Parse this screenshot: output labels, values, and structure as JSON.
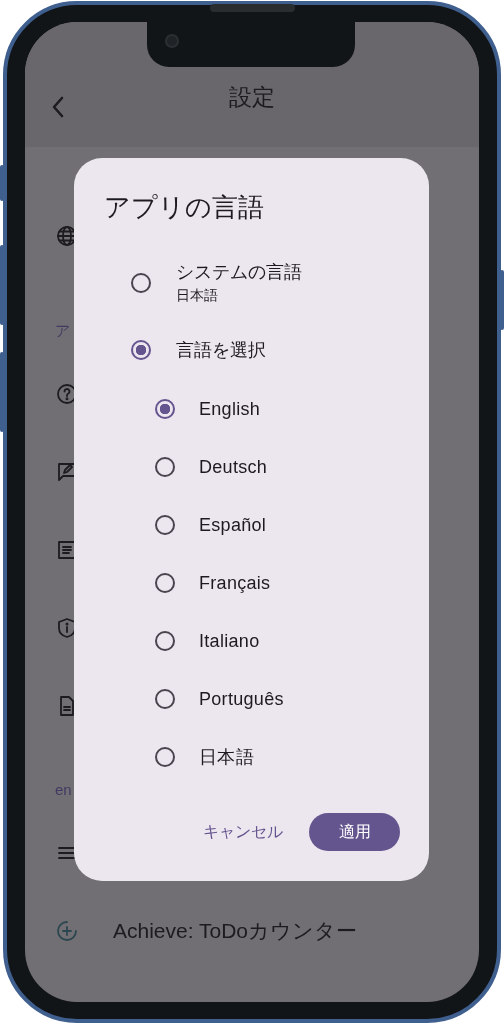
{
  "app_bar": {
    "title": "設定"
  },
  "settings_list": [
    {
      "kind": "item"
    },
    {
      "kind": "header",
      "text": "ア"
    },
    {
      "kind": "item"
    },
    {
      "kind": "item"
    },
    {
      "kind": "item"
    },
    {
      "kind": "item"
    },
    {
      "kind": "item"
    },
    {
      "kind": "header",
      "text": "en"
    },
    {
      "kind": "item"
    },
    {
      "kind": "item",
      "label": "Achieve: ToDoカウンター"
    }
  ],
  "dialog": {
    "title": "アプリの言語",
    "options": [
      {
        "label": "システムの言語",
        "sublabel": "日本語",
        "selected": false
      },
      {
        "label": "言語を選択",
        "selected": true
      }
    ],
    "languages": [
      {
        "label": "English",
        "selected": true
      },
      {
        "label": "Deutsch",
        "selected": false
      },
      {
        "label": "Español",
        "selected": false
      },
      {
        "label": "Français",
        "selected": false
      },
      {
        "label": "Italiano",
        "selected": false
      },
      {
        "label": "Português",
        "selected": false
      },
      {
        "label": "日本語",
        "selected": false
      }
    ],
    "buttons": [
      {
        "label": "キャンセル",
        "kind": "text"
      },
      {
        "label": "適用",
        "kind": "filled"
      }
    ]
  }
}
